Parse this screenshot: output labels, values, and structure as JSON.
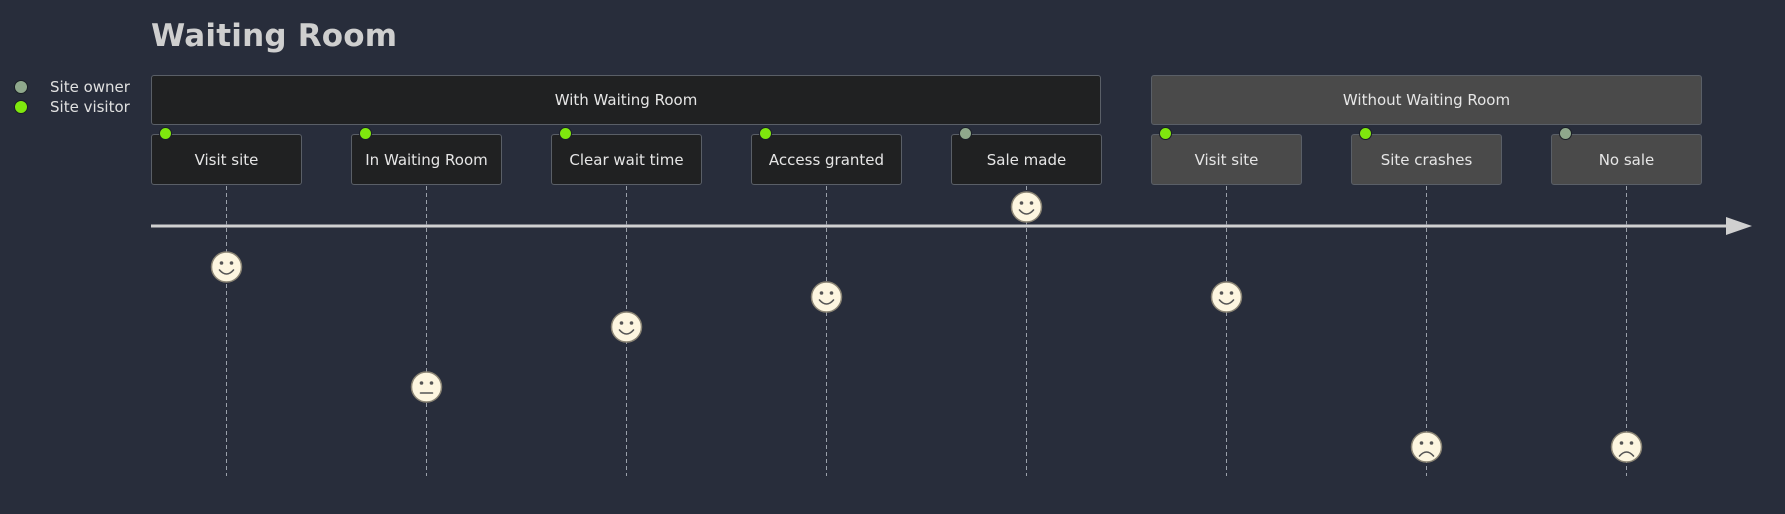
{
  "title": "Waiting Room",
  "colors": {
    "background": "#282d3b",
    "site_owner": "#8fa88c",
    "site_visitor": "#7fe70e",
    "section_dark": "#202122",
    "section_gray": "#4a4a4a",
    "face_fill": "#fdf6e0",
    "axis": "#d0d0d0"
  },
  "legend": [
    {
      "label": "Site owner",
      "color_key": "site_owner"
    },
    {
      "label": "Site visitor",
      "color_key": "site_visitor"
    }
  ],
  "sections": [
    {
      "label": "With Waiting Room",
      "style": "dark"
    },
    {
      "label": "Without Waiting Room",
      "style": "gray"
    }
  ],
  "tasks": [
    {
      "label": "Visit site",
      "section": 0,
      "actor": "site_visitor",
      "score": 4,
      "mood": "happy"
    },
    {
      "label": "In Waiting Room",
      "section": 0,
      "actor": "site_visitor",
      "score": 2,
      "mood": "neutral"
    },
    {
      "label": "Clear wait time",
      "section": 0,
      "actor": "site_visitor",
      "score": 3,
      "mood": "happy"
    },
    {
      "label": "Access granted",
      "section": 0,
      "actor": "site_visitor",
      "score": 3.5,
      "mood": "happy"
    },
    {
      "label": "Sale made",
      "section": 0,
      "actor": "site_owner",
      "score": 5,
      "mood": "happy"
    },
    {
      "label": "Visit site",
      "section": 1,
      "actor": "site_visitor",
      "score": 3.5,
      "mood": "happy"
    },
    {
      "label": "Site crashes",
      "section": 1,
      "actor": "site_visitor",
      "score": 1,
      "mood": "sad"
    },
    {
      "label": "No sale",
      "section": 1,
      "actor": "site_owner",
      "score": 1,
      "mood": "sad"
    }
  ]
}
